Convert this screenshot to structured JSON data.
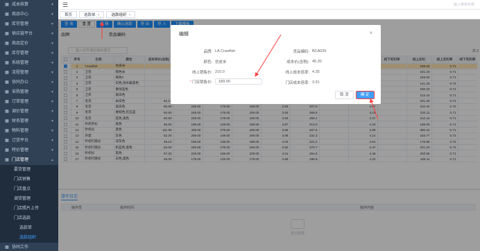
{
  "sidebar": {
    "items": [
      {
        "label": "成本核算",
        "icon": "grid-icon"
      },
      {
        "label": "商品中心",
        "icon": "grid-icon"
      },
      {
        "label": "库存管理",
        "icon": "grid-icon"
      },
      {
        "label": "供应链平台",
        "icon": "grid-icon"
      },
      {
        "label": "商品定价",
        "icon": "grid-icon"
      },
      {
        "label": "库存管理",
        "icon": "grid-icon"
      },
      {
        "label": "系统管理",
        "icon": "grid-icon"
      },
      {
        "label": "流程管理",
        "icon": "grid-icon"
      },
      {
        "label": "协同办公",
        "icon": "grid-icon"
      },
      {
        "label": "采购管理",
        "icon": "grid-icon"
      },
      {
        "label": "订单管理",
        "icon": "grid-icon"
      },
      {
        "label": "调价管理",
        "icon": "grid-icon"
      },
      {
        "label": "财务管理",
        "icon": "grid-icon"
      },
      {
        "label": "物料管理",
        "icon": "grid-icon"
      },
      {
        "label": "订货平台",
        "icon": "grid-icon"
      },
      {
        "label": "特价管理",
        "icon": "grid-icon"
      },
      {
        "label": "门店管理",
        "icon": "grid-icon"
      }
    ],
    "subitems": [
      "要货管理",
      "门店销售",
      "门店盘点",
      "调货管理",
      "门店照片上传",
      "门店选款"
    ],
    "subsubitems": [
      "选款单",
      "选款组织"
    ],
    "last": "协同工作"
  },
  "topbar": {
    "search_placeholder": "输入菜单名称"
  },
  "tags": [
    {
      "label": "首页"
    },
    {
      "label": "选款单"
    },
    {
      "label": "选款组织"
    }
  ],
  "toolbar": [
    "查 询",
    "重 置",
    "编 辑",
    "确认选款",
    "导 出",
    "导 入",
    "下载模板"
  ],
  "filter": {
    "brand_label": "品牌:",
    "code_label": "货品编码:"
  },
  "resource": {
    "placeholder": "输入货号或店铺关键词"
  },
  "pager": {
    "text": "共 2"
  },
  "table": {
    "headers": [
      "",
      "序号",
      "名称",
      "颜色",
      "成本单价(含税)",
      "线上售价",
      "线下售价",
      "线上成本",
      "线下成本",
      "线上毛利",
      "线下毛利",
      "线上毛利率",
      "线下毛利率",
      "线上折扣",
      "线上毛利率",
      "线下毛利率"
    ],
    "rows": [
      {
        "no": "1",
        "name": "Crawfish",
        "color": "仿皮米",
        "c1": "",
        "c2": "",
        "c3": "",
        "c4": "",
        "c5": "",
        "c6": "",
        "c7": "",
        "c8": "4.35",
        "c9": "",
        "c10": "189.00",
        "c11": "0.71",
        "selected": true
      },
      {
        "no": "2",
        "name": "卫衣",
        "color": "褐色米",
        "c1": "",
        "c2": "",
        "c3": "",
        "c4": "",
        "c5": "",
        "c6": "",
        "c7": "",
        "c8": "4.33",
        "c9": "",
        "c10": "221.23",
        "c11": "0.71",
        "selected": false
      },
      {
        "no": "3",
        "name": "卫衣",
        "color": "褐色#",
        "c1": "",
        "c2": "",
        "c3": "",
        "c4": "",
        "c5": "",
        "c6": "",
        "c7": "",
        "c8": "4.21",
        "c9": "",
        "c10": "249.00",
        "c11": "0.71",
        "selected": false
      },
      {
        "no": "4",
        "name": "卫衣",
        "color": "白色,仿水雌黑色",
        "c1": "",
        "c2": "",
        "c3": "",
        "c4": "",
        "c5": "",
        "c6": "",
        "c7": "",
        "c8": "4.44",
        "c9": "",
        "c10": "141.33",
        "c11": "0.72",
        "selected": false
      },
      {
        "no": "5",
        "name": "卫衣",
        "color": "墨绿蓝色",
        "c1": "",
        "c2": "",
        "c3": "",
        "c4": "",
        "c5": "",
        "c6": "",
        "c7": "",
        "c8": "4.30",
        "c9": "",
        "c10": "230.23",
        "c11": "0.71",
        "selected": false
      },
      {
        "no": "6",
        "name": "卫衣",
        "color": "黑白色",
        "c1": "",
        "c2": "",
        "c3": "",
        "c4": "",
        "c5": "",
        "c6": "",
        "c7": "",
        "c8": "4.24",
        "c9": "",
        "c10": "212.44",
        "c11": "0.71",
        "selected": false
      },
      {
        "no": "7",
        "name": "毛衣",
        "color": "米白色",
        "c1": "62.10",
        "c2": "249.00",
        "c3": "179.00",
        "c4": "249.00",
        "c5": "4.01",
        "c6": "176.7",
        "c7": "",
        "c8": "4.43",
        "c9": "",
        "c10": "221.23",
        "c11": "0.71",
        "selected": false
      },
      {
        "no": "8",
        "name": "毛衣",
        "color": "黑白色",
        "c1": "60.80",
        "c2": "249.00",
        "c3": "179.00",
        "c4": "249.00",
        "c5": "3.93",
        "c6": "207.8",
        "c7": "",
        "c8": "4.07",
        "c9": "",
        "c10": "210.44",
        "c11": "0.72",
        "selected": false
      },
      {
        "no": "9",
        "name": "毛衣",
        "color": "栗棕色,红石蓝",
        "c1": "60.80",
        "c2": "249.00",
        "c3": "179.00",
        "c4": "249.00",
        "c5": "3.93",
        "c6": "265.6",
        "c7": "",
        "c8": "4.21",
        "c9": "",
        "c10": "234.11",
        "c11": "0.71",
        "selected": false
      },
      {
        "no": "10",
        "name": "毛衣",
        "color": "驼色,黑色",
        "c1": "60.80",
        "c2": "249.00",
        "c3": "179.00",
        "c4": "249.00",
        "c5": "3.93",
        "c6": "255.4",
        "c7": "",
        "c8": "4.27",
        "c9": "",
        "c10": "212.44",
        "c11": "0.71",
        "selected": false
      },
      {
        "no": "11",
        "name": "针织开衫",
        "color": "黑色",
        "c1": "45.80",
        "c2": "189.00",
        "c3": "129.00",
        "c4": "189.00",
        "c5": "3.87",
        "c6": "210.0",
        "c7": "",
        "c8": "4.33",
        "c9": "",
        "c10": "169.00",
        "c11": "0.71",
        "selected": false
      },
      {
        "no": "12",
        "name": "针织衫",
        "color": "黑色",
        "c1": "111.90",
        "c2": "409.00",
        "c3": "279.00",
        "c4": "409.00",
        "c5": "3.66",
        "c6": "467.6",
        "c7": "",
        "c8": "4.06",
        "c9": "",
        "c10": "380.22",
        "c11": "0.71",
        "selected": false
      },
      {
        "no": "13",
        "name": "外套",
        "color": "灰色",
        "c1": "52.30",
        "c2": "209.00",
        "c3": "149.00",
        "c4": "209.00",
        "c5": "3.88",
        "c6": "232.3",
        "c7": "",
        "c8": "4.14",
        "c9": "",
        "c10": "183.77",
        "c11": "0.72",
        "selected": false
      },
      {
        "no": "14",
        "name": "针织打底衫",
        "color": "深灰色",
        "c1": "49.10",
        "c2": "199.00",
        "c3": "139.00",
        "c4": "199.00",
        "c5": "4.03",
        "c6": "221.2",
        "c7": "",
        "c8": "4.51",
        "c9": "",
        "c10": "176.88",
        "c11": "0.72",
        "selected": false
      },
      {
        "no": "15",
        "name": "针织打底衫",
        "color": "奶蓝色,黑色",
        "c1": "62.50",
        "c2": "249.00",
        "c3": "179.00",
        "c4": "249.00",
        "c5": "3.92",
        "c6": "276.7",
        "c7": "",
        "c8": "4.47",
        "c9": "",
        "c10": "221.23",
        "c11": "0.72",
        "selected": false
      },
      {
        "no": "16",
        "name": "针织衫",
        "color": "黑色",
        "c1": "57.30",
        "c2": "229.00",
        "c3": "159.00",
        "c4": "229.00",
        "c5": "4.01",
        "c6": "254.5",
        "c7": "",
        "c8": "4.46",
        "c9": "",
        "c10": "203.55",
        "c11": "0.71",
        "selected": false
      },
      {
        "no": "17",
        "name": "针织打底衫",
        "color": "白色,黑色",
        "c1": "46.00",
        "c2": "179.00",
        "c3": "129.00",
        "c4": "179.00",
        "c5": "3.89",
        "c6": "198.9",
        "c7": "",
        "c8": "4.22",
        "c9": "",
        "c10": "159.11",
        "c11": "0.71",
        "selected": false
      }
    ]
  },
  "bottom": {
    "tab": "操作日志",
    "headers": [
      "操作员",
      "操作时间",
      "操作内容"
    ],
    "empty": "暂无数据"
  },
  "modal": {
    "title": "编辑",
    "brand_label": "品牌:",
    "brand_value": "LA Crawfish",
    "code_label": "货品编码:",
    "code_value": "BCA025",
    "color_label": "颜色:",
    "color_value": "仿皮米",
    "cost_label": "成本价(含税):",
    "cost_value": "45.30",
    "online_price_label": "线上销售价:",
    "online_price_value": "210.0",
    "online_ratio_label": "线上成本倍率:",
    "online_ratio_value": "4.35",
    "store_price_label": "门店销售价:",
    "store_price_value": "189.00",
    "store_ratio_label": "门店成本倍率:",
    "store_ratio_value": "3.91",
    "cancel": "取 消",
    "confirm": "确 定"
  },
  "colors": {
    "sidebar": "#304156",
    "primary": "#409eff",
    "annotation": "#ff3b3b",
    "selected_row": "#ffe7b8"
  }
}
